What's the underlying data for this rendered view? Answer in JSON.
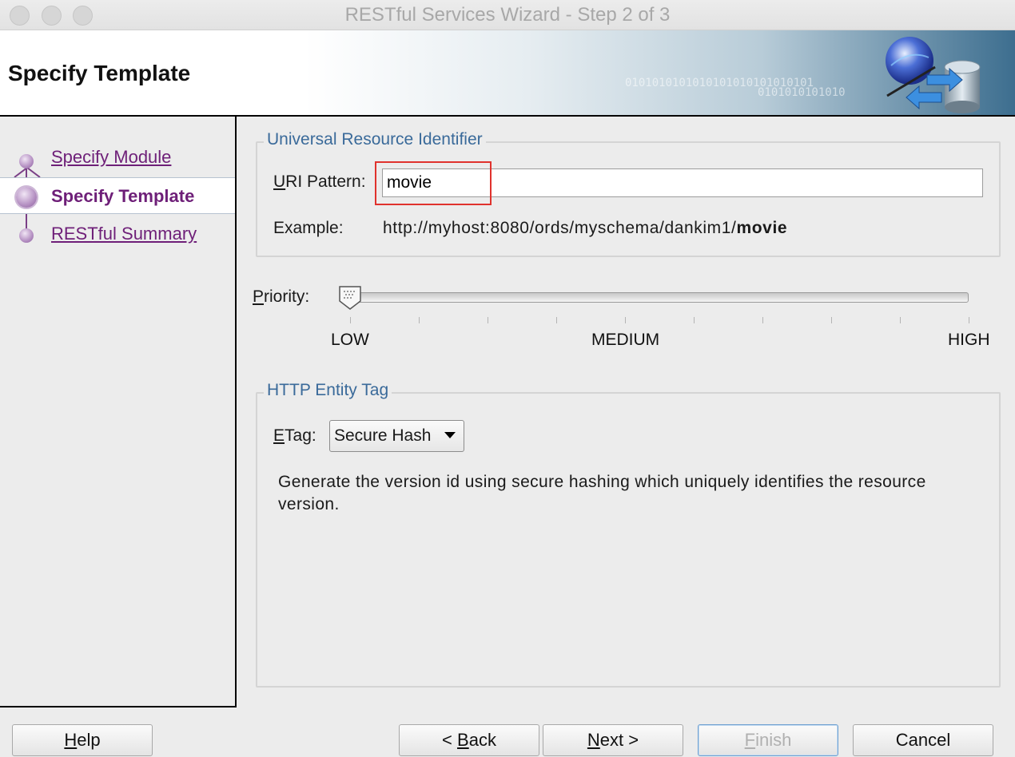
{
  "window": {
    "title": "RESTful Services Wizard - Step 2 of 3"
  },
  "header": {
    "title": "Specify Template",
    "binary_line_1": "0101010101010101010101010101",
    "binary_line_2": "0101010101010"
  },
  "sidebar": {
    "steps": [
      {
        "label": "Specify Module",
        "state": "visited"
      },
      {
        "label": "Specify Template",
        "state": "current"
      },
      {
        "label": "RESTful Summary",
        "state": "pending"
      }
    ]
  },
  "uri_section": {
    "legend": "Universal Resource Identifier",
    "pattern_label_mnemonic": "U",
    "pattern_label_rest": "RI Pattern:",
    "pattern_value": "movie",
    "example_label": "Example:",
    "example_prefix": "http://myhost:8080/ords/myschema/dankim1/",
    "example_suffix": "movie"
  },
  "priority": {
    "label_mnemonic": "P",
    "label_rest": "riority:",
    "value": 0,
    "min": 0,
    "max": 9,
    "tick_labels": {
      "low": "LOW",
      "medium": "MEDIUM",
      "high": "HIGH"
    }
  },
  "etag_section": {
    "legend": "HTTP Entity Tag",
    "label_mnemonic": "E",
    "label_rest": "Tag:",
    "selected": "Secure Hash",
    "description": "Generate the version id using secure hashing which uniquely identifies the resource version."
  },
  "buttons": {
    "help_mnemonic": "H",
    "help_rest": "elp",
    "back_pre": "< ",
    "back_mnemonic": "B",
    "back_rest": "ack",
    "next_mnemonic": "N",
    "next_rest": "ext >",
    "finish_mnemonic": "F",
    "finish_rest": "inish",
    "cancel": "Cancel"
  },
  "colors": {
    "step_link": "#6e1f78",
    "legend_text": "#3a6a9a",
    "highlight": "#e0322d"
  }
}
